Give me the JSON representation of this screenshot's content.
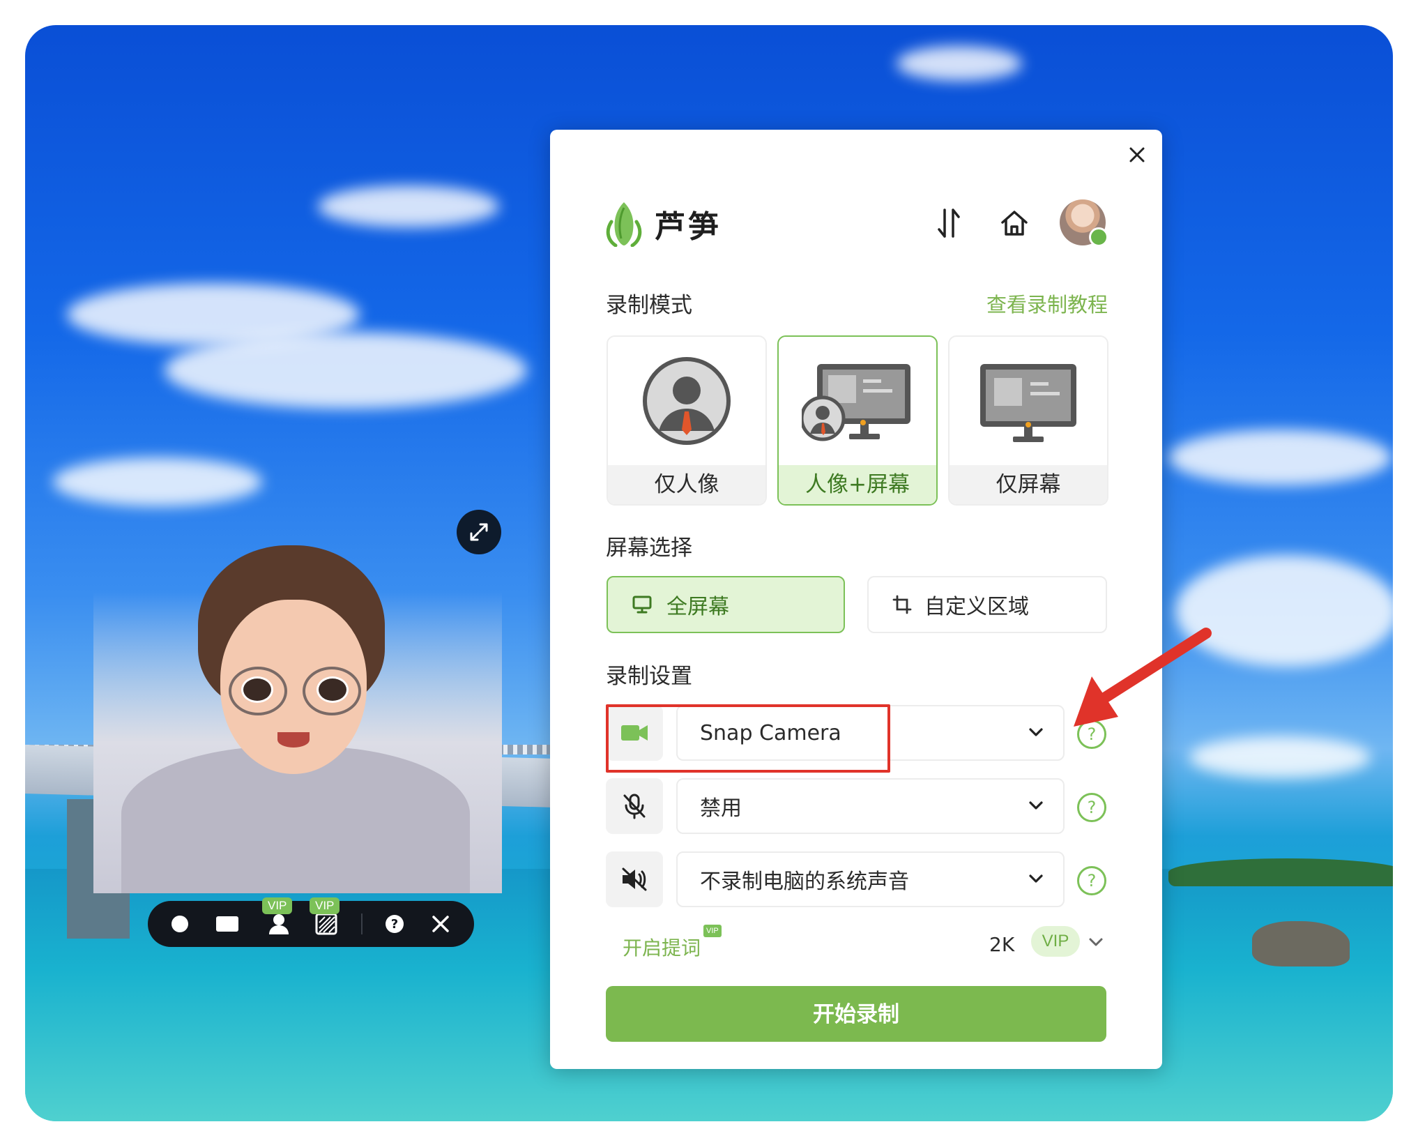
{
  "panel": {
    "brand_name": "芦笋",
    "section_mode_title": "录制模式",
    "tutorial_link": "查看录制教程",
    "modes": [
      {
        "label": "仅人像",
        "active": false
      },
      {
        "label": "人像+屏幕",
        "active": true
      },
      {
        "label": "仅屏幕",
        "active": false
      }
    ],
    "section_screen_title": "屏幕选择",
    "screen_options": [
      {
        "label": "全屏幕",
        "active": true
      },
      {
        "label": "自定义区域",
        "active": false
      }
    ],
    "section_settings_title": "录制设置",
    "camera_select": "Snap Camera",
    "mic_select": "禁用",
    "system_audio_select": "不录制电脑的系统声音",
    "prompt_link": "开启提词",
    "prompt_vip": "VIP",
    "resolution": "2K",
    "resolution_vip": "VIP",
    "start_button": "开始录制",
    "help_glyph": "?"
  },
  "cam_toolbar": {
    "vip_tag_1": "VIP",
    "vip_tag_2": "VIP"
  },
  "colors": {
    "accent": "#7cb94f",
    "accent_light": "#e3f4d6",
    "annotation_red": "#e0332a",
    "toolbar_bg": "#12161d"
  }
}
